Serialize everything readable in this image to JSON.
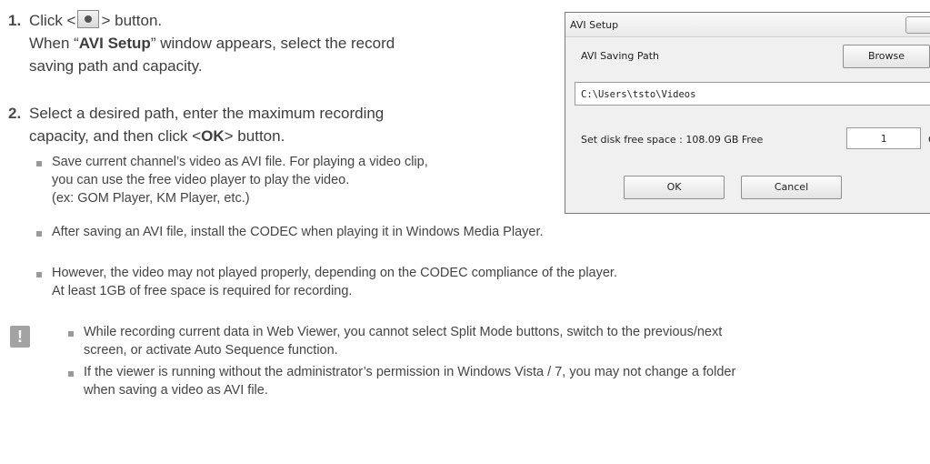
{
  "steps": [
    {
      "number": "1.",
      "line1_pre": "Click <",
      "line1_post": "> button.",
      "line2_a": "When “",
      "line2_bold": "AVI Setup",
      "line2_b": "” window appears, select the record",
      "line3": "saving path and capacity."
    },
    {
      "number": "2.",
      "line1": "Select a desired path, enter the maximum recording",
      "line2_a": "capacity, and then click <",
      "line2_bold": "OK",
      "line2_b": "> button."
    }
  ],
  "step2_bullet": [
    "Save current channel’s video as AVI file. For playing a video clip,",
    "you can use the free video player to play the video.",
    "(ex: GOM Player, KM Player, etc.)"
  ],
  "notes": [
    "After saving an AVI file, install the CODEC when playing it in Windows Media Player.",
    "However, the video may not played properly, depending on the CODEC compliance of the player.",
    "At least 1GB of free space is required for recording."
  ],
  "warnings": [
    [
      "While recording current data in Web Viewer, you cannot select Split Mode buttons, switch to the previous/next",
      "screen, or activate Auto Sequence function."
    ],
    [
      "If the viewer is running without the administrator’s permission in Windows Vista / 7, you may not change a folder",
      "when saving a video as AVI file."
    ]
  ],
  "warning_icon": "!",
  "icons": {
    "record": "record-button-icon",
    "warning": "exclamation-icon",
    "bullet": "square-bullet-icon"
  },
  "dialog": {
    "title": "AVI Setup",
    "saving_path_label": "AVI Saving Path",
    "browse_label": "Browse",
    "path_value": "C:\\Users\\tsto\\Videos",
    "free_space_label": "Set disk free space : 108.09 GB Free",
    "capacity_value": "1",
    "unit": "G",
    "ok_label": "OK",
    "cancel_label": "Cancel"
  }
}
